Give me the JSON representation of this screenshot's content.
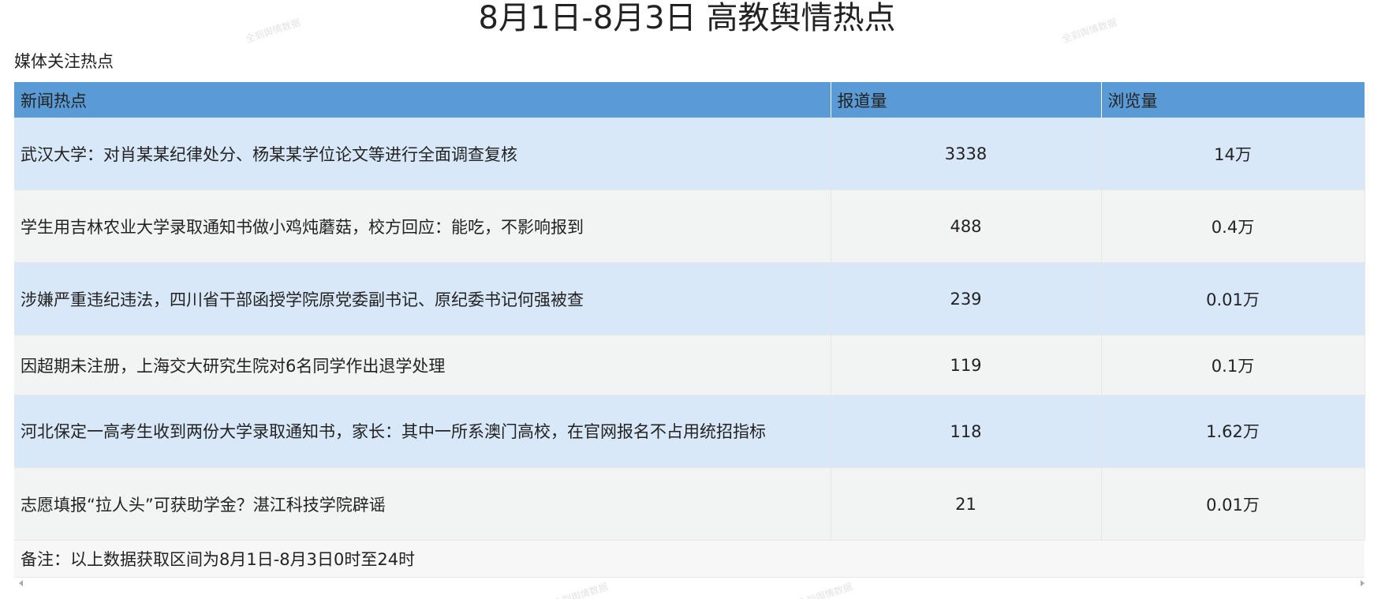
{
  "page": {
    "title": "8月1日-8月3日 高教舆情热点",
    "subtitle": "媒体关注热点"
  },
  "table": {
    "headers": [
      "新闻热点",
      "报道量",
      "浏览量"
    ],
    "rows": [
      {
        "news": "武汉大学：对肖某某纪律处分、杨某某学位论文等进行全面调查复核",
        "reports": "3338",
        "views": "14万"
      },
      {
        "news": "学生用吉林农业大学录取通知书做小鸡炖蘑菇，校方回应：能吃，不影响报到",
        "reports": "488",
        "views": "0.4万"
      },
      {
        "news": "涉嫌严重违纪违法，四川省干部函授学院原党委副书记、原纪委书记何强被查",
        "reports": "239",
        "views": "0.01万"
      },
      {
        "news": "因超期未注册，上海交大研究生院对6名同学作出退学处理",
        "reports": "119",
        "views": "0.1万"
      },
      {
        "news": "河北保定一高考生收到两份大学录取通知书，家长：其中一所系澳门高校，在官网报名不占用统招指标",
        "reports": "118",
        "views": "1.62万"
      },
      {
        "news": "志愿填报“拉人头”可获助学金？湛江科技学院辟谣",
        "reports": "21",
        "views": "0.01万"
      }
    ],
    "note": "备注：以上数据获取区间为8月1日-8月3日0时至24时"
  },
  "colors": {
    "header_bg": "#5b9bd5",
    "row_blue": "#d8e8f8",
    "row_gray": "#f2f3f3"
  },
  "watermark_text": "全到舆情数据"
}
